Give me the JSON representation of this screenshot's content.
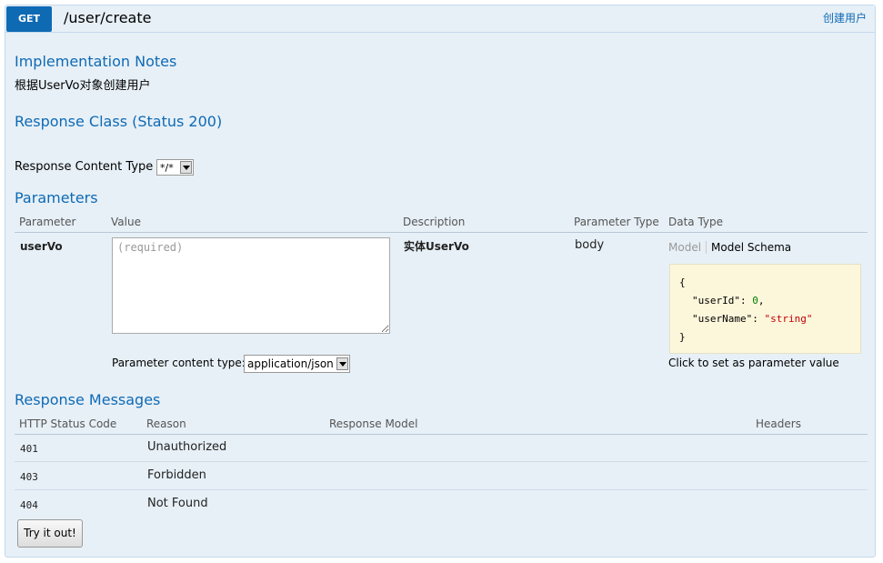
{
  "operation": {
    "method": "GET",
    "path": "/user/create",
    "summary": "创建用户"
  },
  "implementation_notes": {
    "heading": "Implementation Notes",
    "text": "根据UserVo对象创建用户"
  },
  "response_class": {
    "heading": "Response Class (Status 200)",
    "content_type_label": "Response Content Type",
    "content_type_value": "*/*"
  },
  "parameters": {
    "heading": "Parameters",
    "columns": [
      "Parameter",
      "Value",
      "Description",
      "Parameter Type",
      "Data Type"
    ],
    "rows": [
      {
        "name": "userVo",
        "value_placeholder": "(required)",
        "description": "实体UserVo",
        "param_type": "body",
        "data_type_tabs": [
          "Model",
          "Model Schema"
        ],
        "schema": {
          "open": "{",
          "line1_key": "\"userId\"",
          "line1_colon": ": ",
          "line1_value": "0",
          "line1_comma": ",",
          "line2_key": "\"userName\"",
          "line2_colon": ": ",
          "line2_value": "\"string\"",
          "close": "}"
        },
        "schema_hint": "Click to set as parameter value",
        "content_type_label": "Parameter content type:",
        "content_type_value": "application/json"
      }
    ]
  },
  "response_messages": {
    "heading": "Response Messages",
    "columns": [
      "HTTP Status Code",
      "Reason",
      "Response Model",
      "Headers"
    ],
    "rows": [
      {
        "code": "401",
        "reason": "Unauthorized"
      },
      {
        "code": "403",
        "reason": "Forbidden"
      },
      {
        "code": "404",
        "reason": "Not Found"
      }
    ]
  },
  "try_button": "Try it out!",
  "colors": {
    "method_get": "#0f6ab4",
    "panel_bg": "#e7f0f7",
    "panel_border": "#c3d9ec",
    "heading_blue": "#0f6ab4",
    "schema_bg": "#fcf6db"
  }
}
